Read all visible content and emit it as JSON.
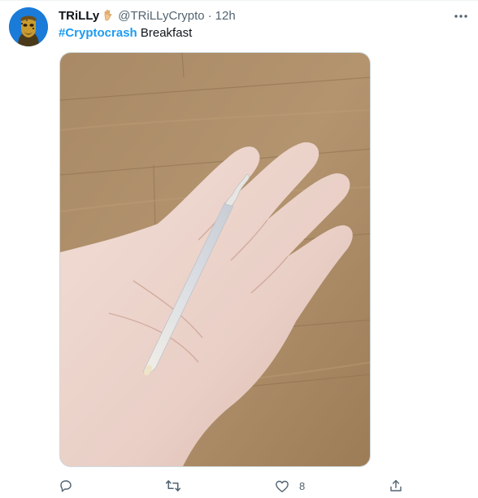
{
  "tweet": {
    "display_name": "TRiLLy",
    "handle": "@TRiLLyCrypto",
    "separator": "·",
    "timestamp": "12h",
    "hashtag": "#Cryptocrash",
    "body_text": "Breakfast",
    "icons": {
      "name_emoji": "hand-emoji-icon",
      "more": "more-options-icon",
      "reply": "reply-icon",
      "retweet": "retweet-icon",
      "like": "like-icon",
      "share": "share-icon"
    },
    "actions": {
      "reply_count": "",
      "retweet_count": "",
      "like_count": "8"
    }
  },
  "colors": {
    "link": "#1d9bf0",
    "secondary_text": "#536471",
    "avatar_bg": "#1a7bd8"
  }
}
